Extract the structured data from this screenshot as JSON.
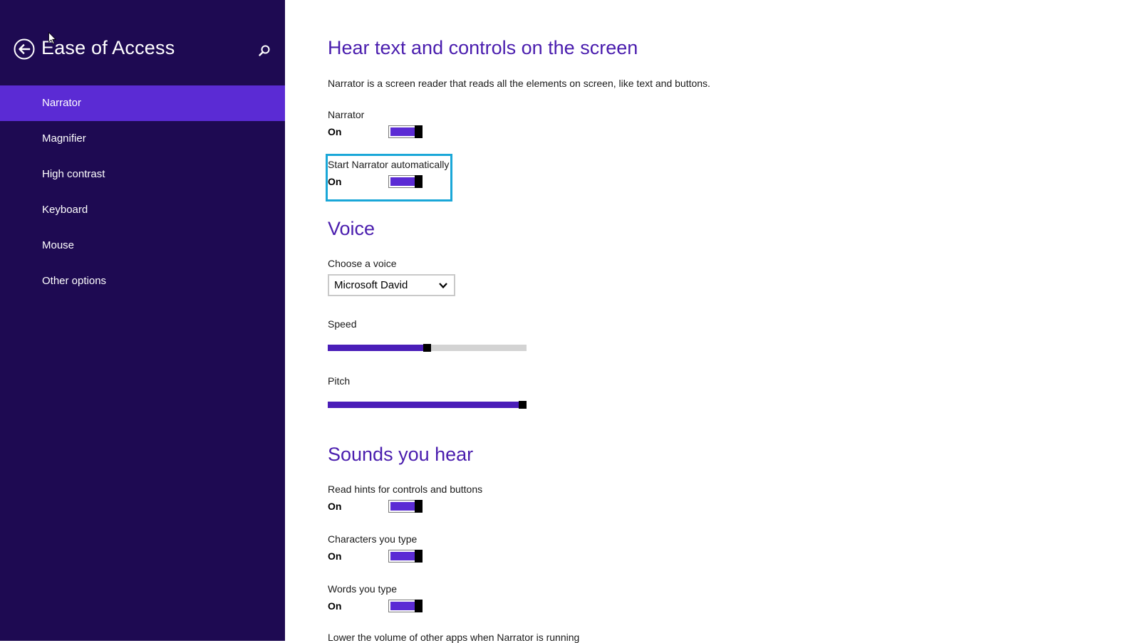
{
  "sidebar": {
    "title": "Ease of Access",
    "items": [
      {
        "label": "Narrator",
        "active": true
      },
      {
        "label": "Magnifier",
        "active": false
      },
      {
        "label": "High contrast",
        "active": false
      },
      {
        "label": "Keyboard",
        "active": false
      },
      {
        "label": "Mouse",
        "active": false
      },
      {
        "label": "Other options",
        "active": false
      }
    ]
  },
  "main": {
    "section_narrator": {
      "heading": "Hear text and controls on the screen",
      "description": "Narrator is a screen reader that reads all the elements on screen, like text and buttons.",
      "narrator": {
        "label": "Narrator",
        "state": "On"
      },
      "start_auto": {
        "label": "Start Narrator automatically",
        "state": "On"
      }
    },
    "section_voice": {
      "heading": "Voice",
      "choose_label": "Choose a voice",
      "voice_value": "Microsoft David",
      "speed": {
        "label": "Speed",
        "value_fraction": 0.5
      },
      "pitch": {
        "label": "Pitch",
        "value_fraction": 1.0
      }
    },
    "section_sounds": {
      "heading": "Sounds you hear",
      "read_hints": {
        "label": "Read hints for controls and buttons",
        "state": "On"
      },
      "characters": {
        "label": "Characters you type",
        "state": "On"
      },
      "words": {
        "label": "Words you type",
        "state": "On"
      },
      "lower_volume": {
        "label": "Lower the volume of other apps when Narrator is running"
      }
    }
  },
  "colors": {
    "sidebar_bg": "#1e0a52",
    "accent": "#5b2bd4",
    "heading": "#4a1dae",
    "focus": "#1aa7d8"
  },
  "icons": [
    "back-arrow-icon",
    "search-icon",
    "chevron-down-icon",
    "mouse-cursor-icon"
  ]
}
